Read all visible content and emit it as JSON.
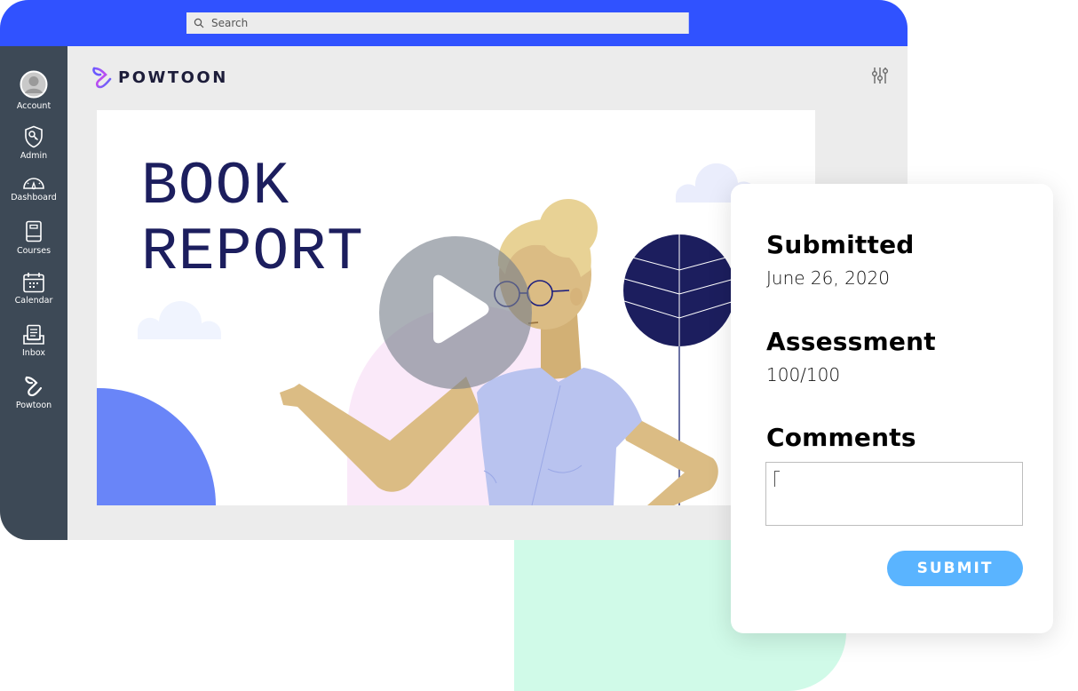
{
  "search": {
    "placeholder": "Search",
    "icon": "search-icon"
  },
  "sidebar": {
    "items": [
      {
        "label": "Account",
        "icon": "account-icon"
      },
      {
        "label": "Admin",
        "icon": "admin-key-shield-icon"
      },
      {
        "label": "Dashboard",
        "icon": "dashboard-gauge-icon"
      },
      {
        "label": "Courses",
        "icon": "book-icon"
      },
      {
        "label": "Calendar",
        "icon": "calendar-icon"
      },
      {
        "label": "Inbox",
        "icon": "inbox-tray-icon"
      },
      {
        "label": "Powtoon",
        "icon": "powtoon-icon"
      }
    ]
  },
  "header": {
    "brand": "POWTOON",
    "filter_icon": "sliders-icon"
  },
  "video": {
    "title_line1": "BOOK",
    "title_line2": "REPORT",
    "play_icon": "play-icon"
  },
  "card": {
    "submitted_label": "Submitted",
    "submitted_value": "June 26, 2020",
    "assessment_label": "Assessment",
    "assessment_value": "100/100",
    "comments_label": "Comments",
    "comments_value": "",
    "submit_label": "SUBMIT"
  },
  "colors": {
    "topbar": "#3052ff",
    "sidebar": "#3d4956",
    "title": "#1c1e5e",
    "submit": "#5ab4ff",
    "mint": "#d0fae8"
  }
}
